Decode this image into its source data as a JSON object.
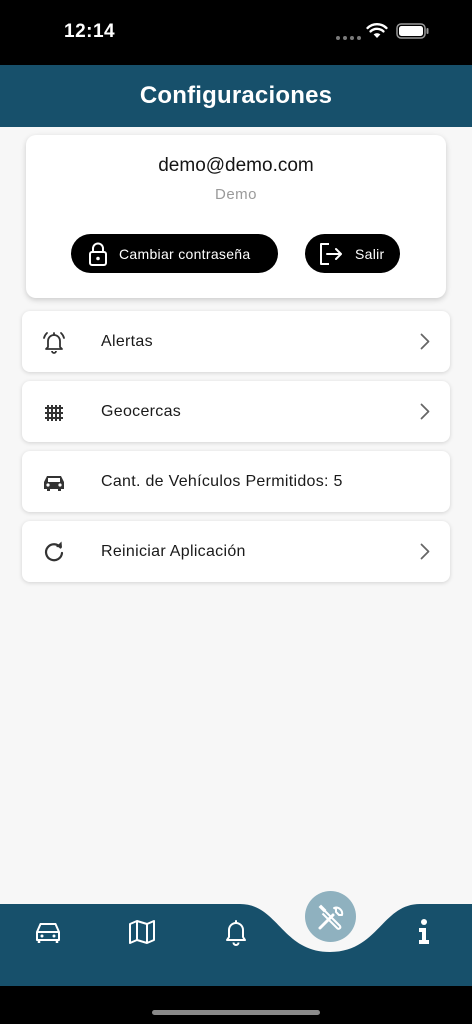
{
  "status_bar": {
    "time": "12:14"
  },
  "header": {
    "title": "Configuraciones"
  },
  "account": {
    "email": "demo@demo.com",
    "name": "Demo",
    "change_password_label": "Cambiar contraseña",
    "logout_label": "Salir"
  },
  "menu": [
    {
      "label": "Alertas",
      "icon": "alarm-bell-icon",
      "has_chevron": true
    },
    {
      "label": "Geocercas",
      "icon": "fence-grid-icon",
      "has_chevron": true
    },
    {
      "label": "Cant. de Vehículos Permitidos: 5",
      "icon": "car-icon",
      "has_chevron": false
    },
    {
      "label": "Reiniciar Aplicación",
      "icon": "refresh-icon",
      "has_chevron": true
    }
  ],
  "bottom_nav": {
    "items": [
      "car-icon",
      "map-icon",
      "bell-icon",
      "tools-icon",
      "info-icon"
    ],
    "active": "tools-icon"
  },
  "colors": {
    "primary": "#17506b",
    "fab": "#8fb1bf",
    "background": "#f7f7f7"
  }
}
